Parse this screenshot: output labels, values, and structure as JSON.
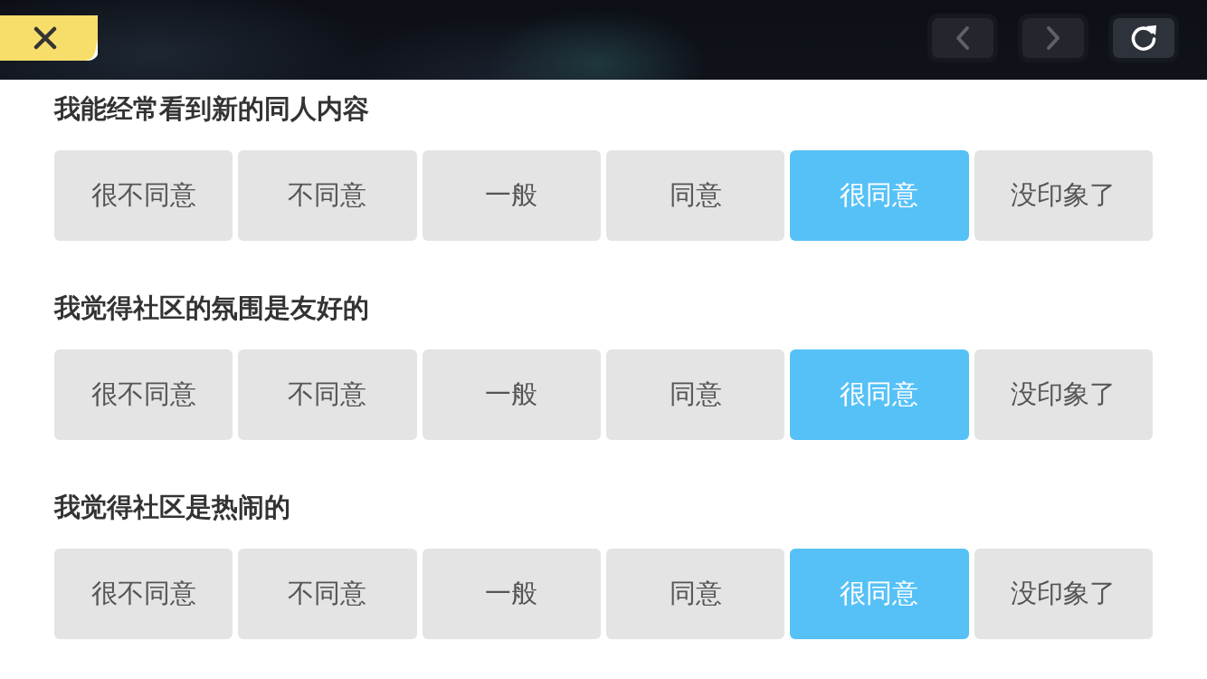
{
  "header": {
    "nav_buttons": [
      {
        "kind": "prev",
        "disabled": true
      },
      {
        "kind": "next",
        "disabled": true
      },
      {
        "kind": "refresh",
        "disabled": false
      }
    ]
  },
  "questions": [
    {
      "title": "我能经常看到新的同人内容",
      "options": [
        {
          "label": "很不同意",
          "selected": false
        },
        {
          "label": "不同意",
          "selected": false
        },
        {
          "label": "一般",
          "selected": false
        },
        {
          "label": "同意",
          "selected": false
        },
        {
          "label": "很同意",
          "selected": true
        },
        {
          "label": "没印象了",
          "selected": false
        }
      ]
    },
    {
      "title": "我觉得社区的氛围是友好的",
      "options": [
        {
          "label": "很不同意",
          "selected": false
        },
        {
          "label": "不同意",
          "selected": false
        },
        {
          "label": "一般",
          "selected": false
        },
        {
          "label": "同意",
          "selected": false
        },
        {
          "label": "很同意",
          "selected": true
        },
        {
          "label": "没印象了",
          "selected": false
        }
      ]
    },
    {
      "title": "我觉得社区是热闹的",
      "options": [
        {
          "label": "很不同意",
          "selected": false
        },
        {
          "label": "不同意",
          "selected": false
        },
        {
          "label": "一般",
          "selected": false
        },
        {
          "label": "同意",
          "selected": false
        },
        {
          "label": "很同意",
          "selected": true
        },
        {
          "label": "没印象了",
          "selected": false
        }
      ]
    }
  ]
}
